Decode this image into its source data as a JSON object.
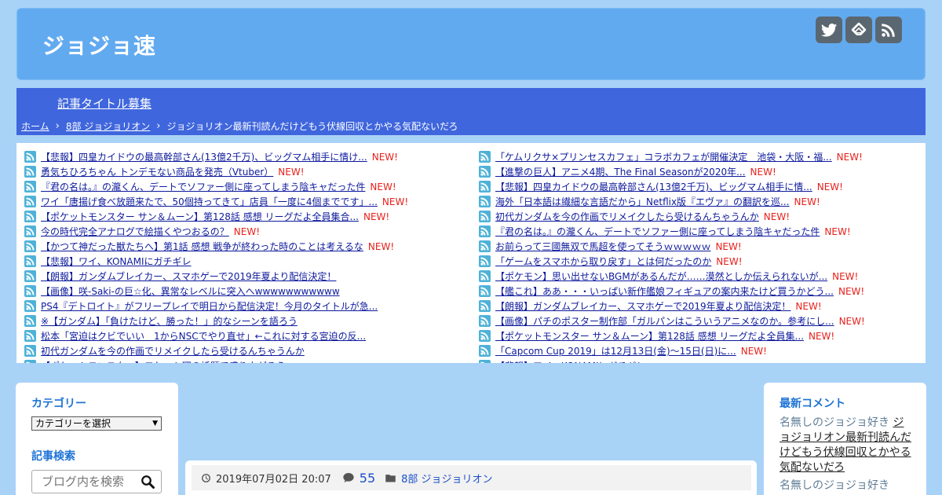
{
  "header": {
    "site_title": "ジョジョ速",
    "social": [
      "twitter-icon",
      "feedly-icon",
      "rss-icon"
    ]
  },
  "nav": {
    "link": "記事タイトル募集"
  },
  "breadcrumb": {
    "home": "ホーム",
    "category": "8部 ジョジョリオン",
    "current": "ジョジョリオン最新刊読んだけどもう伏線回収とかやる気配ないだろ",
    "separator": "›"
  },
  "rss": {
    "new_label": "NEW!",
    "left": [
      {
        "title": "【悲報】四皇カイドウの最高幹部さん(13億2千万)、ビッグマム相手に情け...",
        "new": true
      },
      {
        "title": "勇気ちひろちゃん トンデモない商品を発売（Vtuber）",
        "new": true
      },
      {
        "title": "『君の名は。』の瀧くん、デートでソファー側に座ってしまう陰キャだった件",
        "new": true
      },
      {
        "title": "ワイ「唐揚げ食べ放題来たで、50個持ってきて」店員「一度に4個までです」...",
        "new": true
      },
      {
        "title": "【ポケットモンスター サン＆ムーン】第128話 感想 リーグだよ全員集合...",
        "new": true
      },
      {
        "title": "今の時代完全アナログで絵描くやつおるの？",
        "new": true
      },
      {
        "title": "【かつて神だった獣たちへ】第1話 感想 戦争が終わった時のことは考えるな",
        "new": true
      },
      {
        "title": "【悲報】ワイ、KONAMIにガチギレ",
        "new": false
      },
      {
        "title": "【朗報】ガンダムブレイカー、スマホゲーで2019年夏より配信決定！",
        "new": false
      },
      {
        "title": "【画像】咲-Saki-の巨☆化、異常なレベルに突入へwwwwwwwwwww",
        "new": false
      },
      {
        "title": "PS4『デトロイト』がフリープレイで明日から配信決定！今月のタイトルが急...",
        "new": false
      },
      {
        "title": "※【ガンダム】「負けたけど、勝った！」的なシーンを語ろう",
        "new": false
      },
      {
        "title": "松本「宮迫はクビでいい　1からNSCでやり直せ」←これに対する宮迫の反...",
        "new": false
      },
      {
        "title": "初代ガンダムを今の作画でリメイクしたら受けるんちゃうんか",
        "new": false
      },
      {
        "title": "【ポケットモンスター】ロケット団の話題で盛り上がろう",
        "new": false
      }
    ],
    "right": [
      {
        "title": "「ケムリクサ×プリンセスカフェ」コラボカフェが開催決定　池袋・大阪・福...",
        "new": true
      },
      {
        "title": "【進撃の巨人】アニメ4期、The Final Seasonが2020年...",
        "new": true
      },
      {
        "title": "【悲報】四皇カイドウの最高幹部さん(13億2千万)、ビッグマム相手に情...",
        "new": true
      },
      {
        "title": "海外「日本語は繊細な言語だから」Netflix版『エヴァ』の翻訳を巡...",
        "new": true
      },
      {
        "title": "初代ガンダムを今の作画でリメイクしたら受けるんちゃうんか",
        "new": true
      },
      {
        "title": "『君の名は。』の瀧くん、デートでソファー側に座ってしまう陰キャだった件",
        "new": true
      },
      {
        "title": "お前らって三國無双で馬超を使ってそうｗｗｗｗｗ",
        "new": true
      },
      {
        "title": "「ゲームをスマホから取り戻す」とは何だったのか",
        "new": true
      },
      {
        "title": "【ポケモン】思い出せないBGMがあるんだが……漠然としか伝えられないが...",
        "new": true
      },
      {
        "title": "【艦これ】ああ・・・いっぱい新作艦娘フィギュアの案内来たけど買うかどう...",
        "new": true
      },
      {
        "title": "【朗報】ガンダムブレイカー、スマホゲーで2019年夏より配信決定！",
        "new": true
      },
      {
        "title": "【画像】パチのポスター制作部「ガルパンはこういうアニメなのか。参考にし...",
        "new": true
      },
      {
        "title": "【ポケットモンスター サン＆ムーン】第128話 感想 リーグだよ全員集...",
        "new": true
      },
      {
        "title": "「Capcom Cup 2019」は12月13日(金)～15日(日)に...",
        "new": true
      },
      {
        "title": "【悲報】ワイ、KONAMIにガチギレ",
        "new": false
      }
    ]
  },
  "sidebar_left": {
    "category_heading": "カテゴリー",
    "category_select": "カテゴリーを選択",
    "search_heading": "記事検索",
    "search_placeholder": "ブログ内を検索"
  },
  "post_meta": {
    "date": "2019年07月02日 20:07",
    "comments": "55",
    "category": "8部 ジョジョリオン"
  },
  "sidebar_right": {
    "heading": "最新コメント",
    "comments": [
      {
        "author": "名無しのジョジョ好き",
        "title": "ジョジョリオン最新刊読んだけどもう伏線回収とかやる気配ないだろ"
      },
      {
        "author": "名無しのジョジョ好き",
        "title": ""
      }
    ]
  },
  "colors": {
    "background": "#a9d2f7",
    "header": "#62aaf0",
    "navbar": "#3f66dd",
    "accent": "#1e73d6",
    "new": "#e8201b",
    "link": "#0d1a9c"
  }
}
